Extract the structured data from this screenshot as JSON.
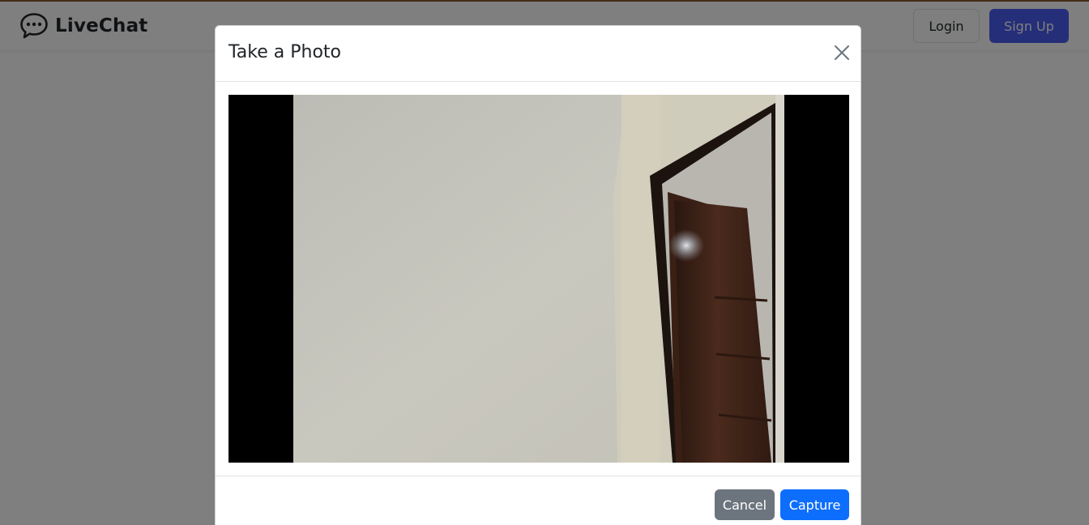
{
  "app": {
    "brand_name": "LiveChat",
    "brand_icon": "speech-bubble-icon"
  },
  "header": {
    "login_label": "Login",
    "signup_label": "Sign Up"
  },
  "modal": {
    "title": "Take a Photo",
    "close_icon": "close-icon",
    "cancel_label": "Cancel",
    "capture_label": "Capture"
  },
  "colors": {
    "primary": "#0d6efd",
    "secondary": "#6c757d",
    "signup": "#4a5cf2",
    "accent_line": "#8a5a32"
  }
}
